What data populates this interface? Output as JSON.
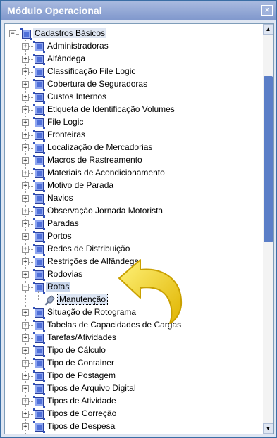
{
  "window": {
    "title": "Módulo Operacional",
    "close_glyph": "×"
  },
  "tree": {
    "root": "Cadastros Básicos",
    "items": [
      "Administradoras",
      "Alfândega",
      "Classificação File Logic",
      "Cobertura de Seguradoras",
      "Custos Internos",
      "Etiqueta de Identificação Volumes",
      "File Logic",
      "Fronteiras",
      "Localização de Mercadorias",
      "Macros de Rastreamento",
      "Materiais de Acondicionamento",
      "Motivo de Parada",
      "Navios",
      "Observação Jornada Motorista",
      "Paradas",
      "Portos",
      "Redes de Distribuição",
      "Restrições de Alfândega",
      "Rodovias",
      "Rotas",
      "Situação de Rotograma",
      "Tabelas de Capacidades de Cargas",
      "Tarefas/Atividades",
      "Tipo de Cálculo",
      "Tipo de Container",
      "Tipo de Postagem",
      "Tipos de Arquivo Digital",
      "Tipos de Atividade",
      "Tipos de Correção",
      "Tipos de Despesa"
    ],
    "expanded_item": "Rotas",
    "child": {
      "label": "Manutenção",
      "icon": "wrench-icon"
    }
  },
  "scrollbar": {
    "up_glyph": "▲",
    "down_glyph": "▼"
  },
  "colors": {
    "titlebar": "#8ba1d4",
    "node_icon": "#4f6fd8",
    "arrow": "#f2d21a"
  }
}
